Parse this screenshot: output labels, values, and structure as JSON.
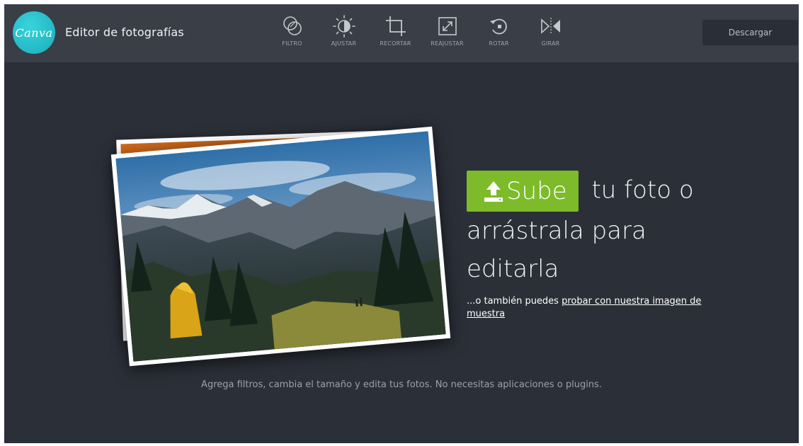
{
  "app": {
    "logo_text": "Canva",
    "title": "Editor de fotografías"
  },
  "toolbar": {
    "tools": [
      {
        "label": "FILTRO",
        "icon": "filter-icon"
      },
      {
        "label": "AJUSTAR",
        "icon": "brightness-icon"
      },
      {
        "label": "RECORTAR",
        "icon": "crop-icon"
      },
      {
        "label": "REAJUSTAR",
        "icon": "resize-icon"
      },
      {
        "label": "ROTAR",
        "icon": "rotate-icon"
      },
      {
        "label": "GIRAR",
        "icon": "flip-icon"
      }
    ],
    "download_label": "Descargar"
  },
  "upload": {
    "button_label": "Sube",
    "headline_rest_1": "tu foto o",
    "headline_line_2": "arrástrala para",
    "headline_line_3": "editarla",
    "sub_prefix": "...o también puedes ",
    "sub_link": "probar con nuestra imagen de muestra"
  },
  "footer": {
    "text": "Agrega filtros, cambia el tamaño y edita tus fotos. No necesitas aplicaciones o plugins."
  },
  "colors": {
    "background": "#2b2f38",
    "topbar": "#3a3e47",
    "logo": "#22b9c4",
    "upload_button": "#7dbb2a"
  }
}
